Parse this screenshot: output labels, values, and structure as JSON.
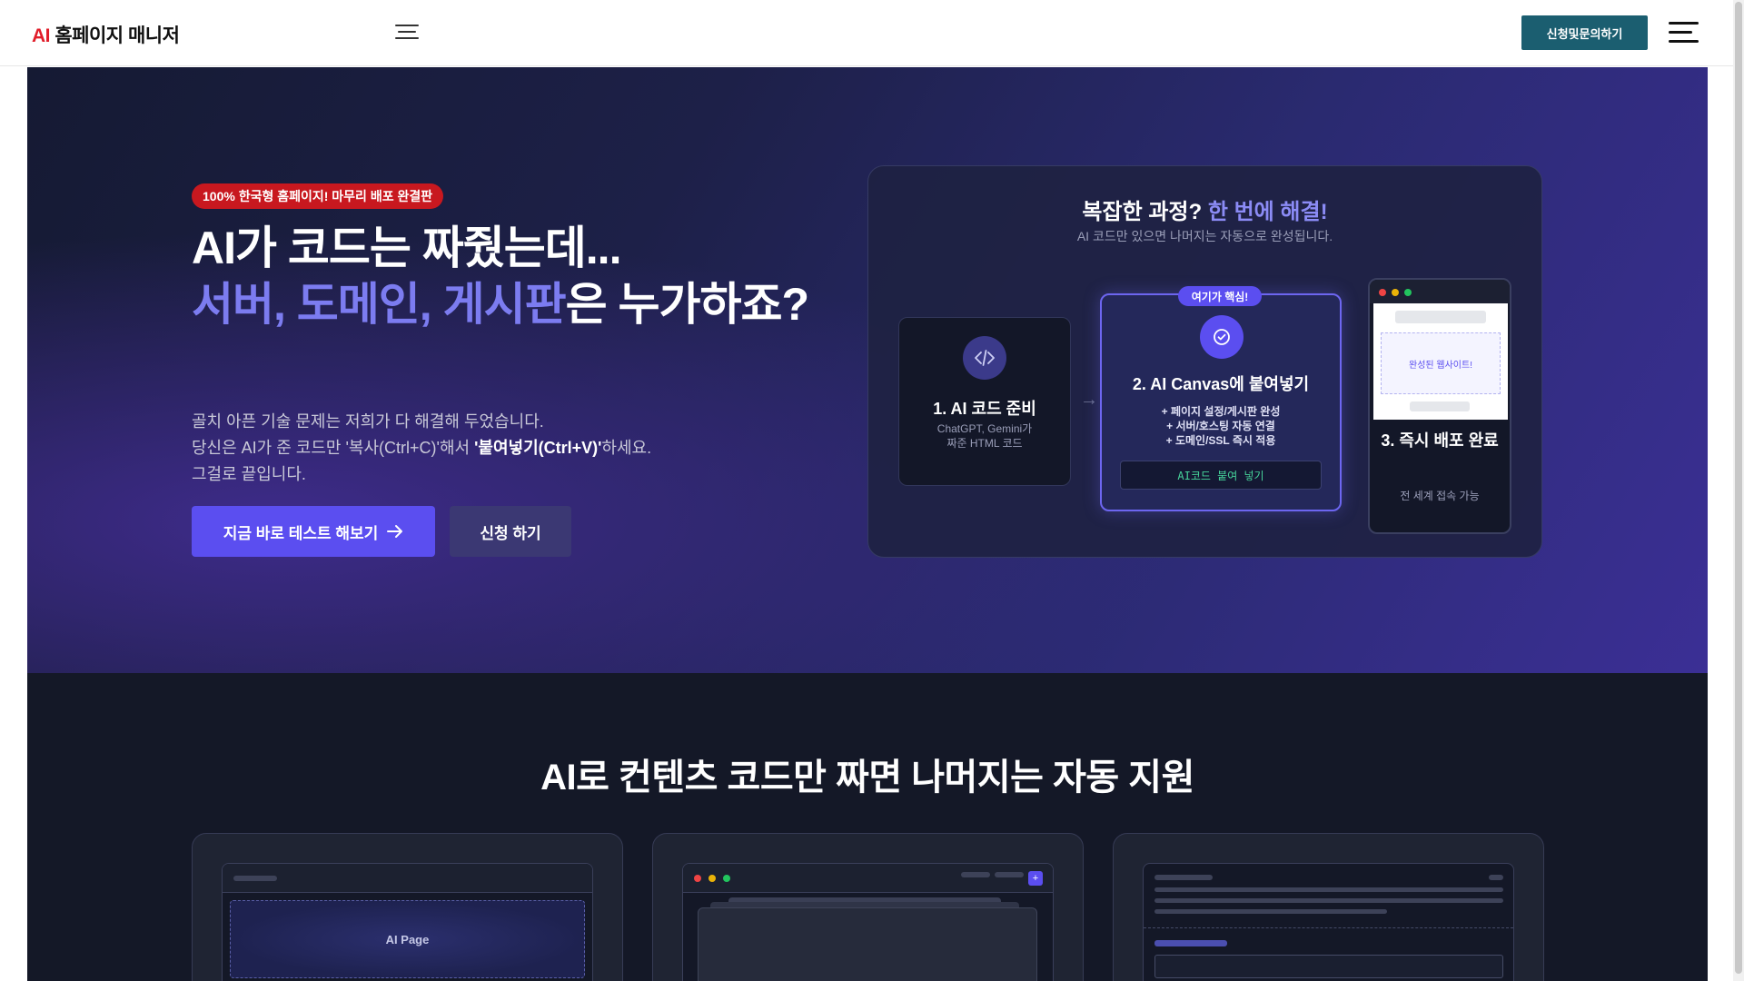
{
  "header": {
    "logo_ai": "AI",
    "logo_text": "홈페이지 매니저",
    "apply_button": "신청및문의하기"
  },
  "hero": {
    "badge": "100% 한국형 홈페이지! 마무리 배포 완결판",
    "headline_line1": "AI가 코드는 짜줬는데...",
    "headline_accent": "서버, 도메인, 게시판",
    "headline_rest": "은 누가하죠?",
    "sub_line1": "골치 아픈 기술 문제는 저희가 다 해결해 두었습니다.",
    "sub_line2_pre": "당신은 AI가 준 코드만 '복사(Ctrl+C)'해서 ",
    "sub_line2_bold": "'붙여넣기(Ctrl+V)'",
    "sub_line2_post": "하세요.",
    "sub_line3": "그걸로 끝입니다.",
    "btn_primary": "지금 바로 테스트 해보기",
    "btn_secondary": "신청 하기"
  },
  "panel": {
    "title_pre": "복잡한 과정? ",
    "title_highlight": "한 번에 해결!",
    "subtitle": "AI 코드만 있으면 나머지는 자동으로 완성됩니다.",
    "arrow": "→",
    "step1": {
      "title": "1. AI 코드 준비",
      "desc_line1": "ChatGPT, Gemini가",
      "desc_line2": "짜준 HTML 코드"
    },
    "step2": {
      "tag": "여기가 핵심!",
      "title": "2. AI Canvas에 붙여넣기",
      "items": [
        "+ 페이지 설정/게시판 완성",
        "+ 서버/호스팅 자동 연결",
        "+ 도메인/SSL 즉시 적용"
      ],
      "paste_box": "AI코드 붙여 넣기"
    },
    "step3": {
      "screen_label": "완성된 웹사이트!",
      "title": "3. 즉시 배포 완료",
      "desc": "전 세계 접속 가능"
    }
  },
  "features": {
    "title": "AI로 컨텐츠 코드만 짜면 나머지는 자동 지원",
    "card1_label": "AI Page",
    "card2_plus": "+"
  },
  "colors": {
    "accent": "#5b4ef0",
    "badge_red": "#c8181f",
    "apply_teal": "#1b5e70",
    "highlight": "#7c7cf0"
  }
}
